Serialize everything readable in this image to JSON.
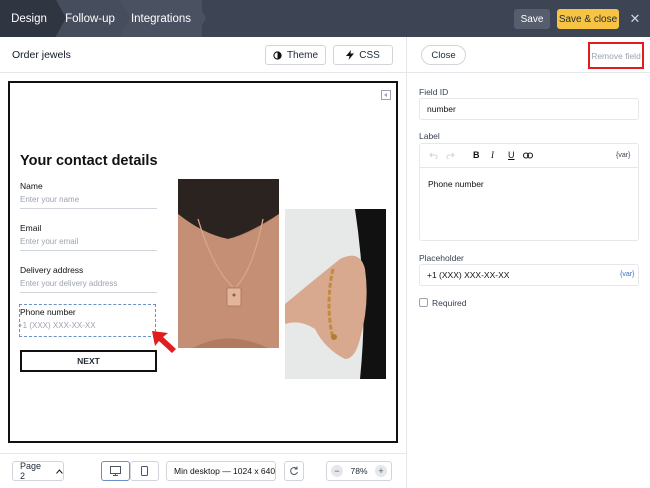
{
  "topbar": {
    "tabs": [
      "Design",
      "Follow-up",
      "Integrations"
    ],
    "save_label": "Save",
    "save_close_label": "Save & close",
    "close_symbol": "✕"
  },
  "left_header": {
    "form_name": "Order jewels",
    "theme_label": "Theme",
    "css_label": "CSS"
  },
  "form": {
    "title": "Your contact details",
    "fields": [
      {
        "label": "Name",
        "placeholder": "Enter your name"
      },
      {
        "label": "Email",
        "placeholder": "Enter your email"
      },
      {
        "label": "Delivery address",
        "placeholder": "Enter your delivery address"
      },
      {
        "label": "Phone number",
        "placeholder": "+1 (XXX) XXX-XX-XX"
      }
    ],
    "next_label": "NEXT"
  },
  "bottombar": {
    "page_label": "Page 2",
    "min_desktop_label": "Min desktop — 1024 x 640",
    "zoom_level": "78%",
    "zoom_minus": "−",
    "zoom_plus": "+"
  },
  "right_panel": {
    "close_label": "Close",
    "remove_label": "Remove field",
    "field_id_label": "Field ID",
    "field_id_value": "number",
    "label_label": "Label",
    "label_value": "Phone number",
    "var_tag": "{var}",
    "placeholder_label": "Placeholder",
    "placeholder_value": "+1 (XXX) XXX-XX-XX",
    "required_label": "Required",
    "toolbar": {
      "bold": "B",
      "italic": "I",
      "underline": "U"
    }
  },
  "colors": {
    "topbar_bg": "#3d4453",
    "accent_yellow": "#f6c343",
    "highlight_red": "#e11d1d",
    "selection_blue": "#6b8fc9"
  }
}
